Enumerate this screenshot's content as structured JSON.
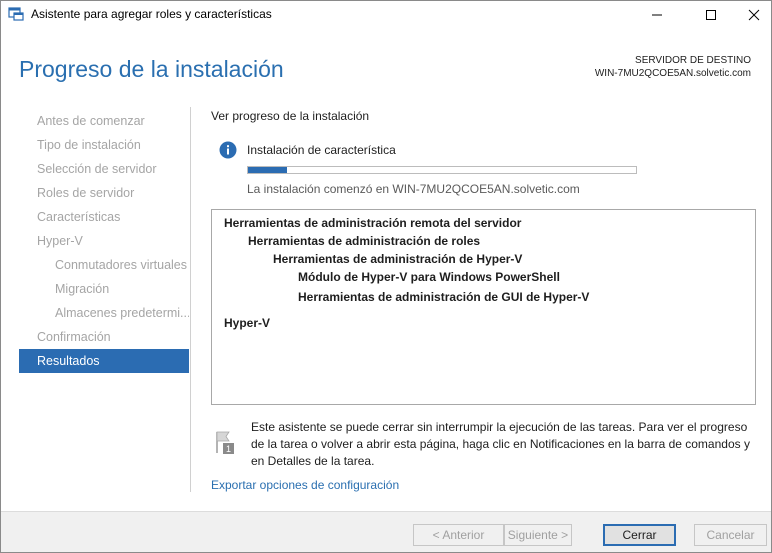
{
  "window": {
    "title": "Asistente para agregar roles y características"
  },
  "header": {
    "page_title": "Progreso de la instalación",
    "destination_label": "SERVIDOR DE DESTINO",
    "destination_server": "WIN-7MU2QCOE5AN.solvetic.com"
  },
  "nav": {
    "items": [
      {
        "label": "Antes de comenzar"
      },
      {
        "label": "Tipo de instalación"
      },
      {
        "label": "Selección de servidor"
      },
      {
        "label": "Roles de servidor"
      },
      {
        "label": "Características"
      },
      {
        "label": "Hyper-V"
      },
      {
        "label": "Conmutadores virtuales"
      },
      {
        "label": "Migración"
      },
      {
        "label": "Almacenes predetermi..."
      },
      {
        "label": "Confirmación"
      },
      {
        "label": "Resultados"
      }
    ],
    "active_index": 10
  },
  "main": {
    "heading": "Ver progreso de la instalación",
    "status_label": "Instalación de característica",
    "progress_fraction": 0.1,
    "progress_caption": "La instalación comenzó en WIN-7MU2QCOE5AN.solvetic.com",
    "features": [
      "Herramientas de administración remota del servidor",
      "Herramientas de administración de roles",
      "Herramientas de administración de Hyper-V",
      "Módulo de Hyper-V para Windows PowerShell",
      "Herramientas de administración de GUI de Hyper-V",
      "Hyper-V"
    ],
    "note": "Este asistente se puede cerrar sin interrumpir la ejecución de las tareas. Para ver el progreso de la tarea o volver a abrir esta página, haga clic en Notificaciones en la barra de comandos y en Detalles de la tarea.",
    "note_badge": "1",
    "export_link": "Exportar opciones de configuración"
  },
  "footer": {
    "previous": "< Anterior",
    "next": "Siguiente >",
    "close": "Cerrar",
    "cancel": "Cancelar"
  },
  "colors": {
    "accent": "#2b6cb2",
    "title_blue": "#2a6fb0",
    "nav_disabled": "#a5a5a5"
  }
}
